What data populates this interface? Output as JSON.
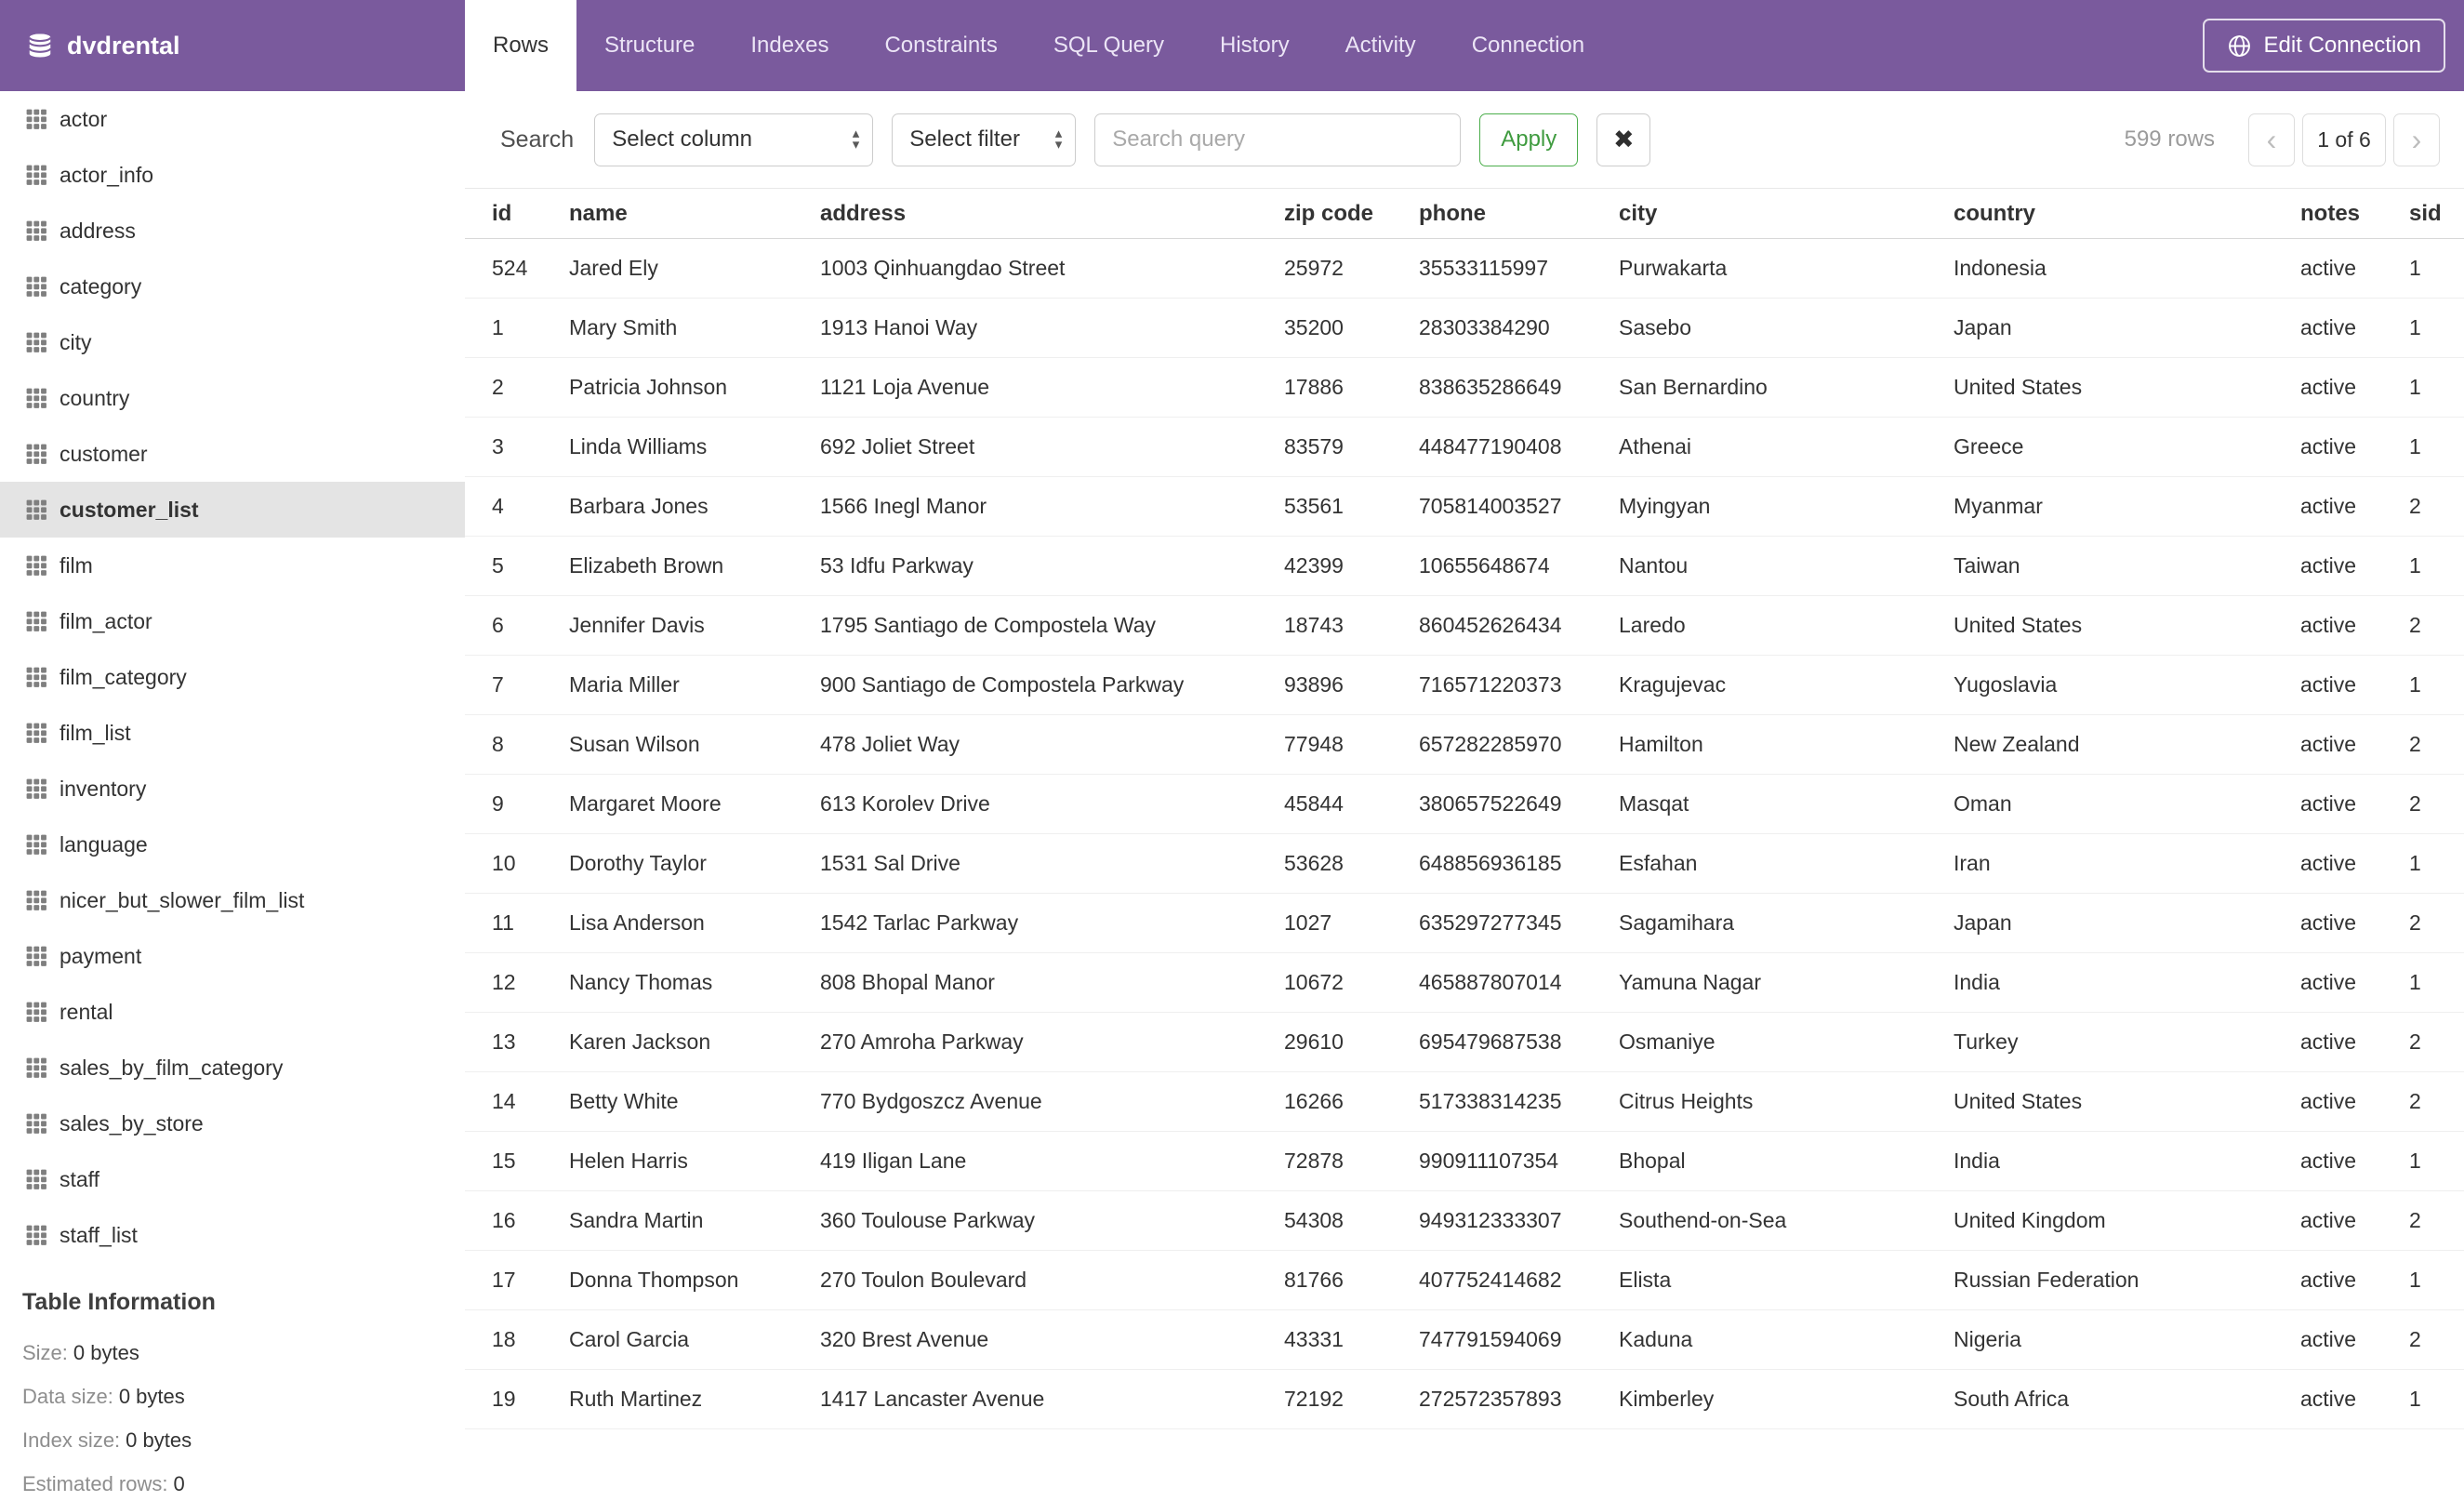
{
  "colors": {
    "header_purple": "#7a5a9d",
    "apply_green": "#4cae4c",
    "selected_row_bg": "#e4e4e4"
  },
  "app": {
    "title": "dvdrental",
    "edit_connection_label": "Edit Connection",
    "tabs": [
      {
        "label": "Rows",
        "active": true
      },
      {
        "label": "Structure",
        "active": false
      },
      {
        "label": "Indexes",
        "active": false
      },
      {
        "label": "Constraints",
        "active": false
      },
      {
        "label": "SQL Query",
        "active": false
      },
      {
        "label": "History",
        "active": false
      },
      {
        "label": "Activity",
        "active": false
      },
      {
        "label": "Connection",
        "active": false
      }
    ]
  },
  "sidebar": {
    "selected_table": "customer_list",
    "tables": [
      "actor",
      "actor_info",
      "address",
      "category",
      "city",
      "country",
      "customer",
      "customer_list",
      "film",
      "film_actor",
      "film_category",
      "film_list",
      "inventory",
      "language",
      "nicer_but_slower_film_list",
      "payment",
      "rental",
      "sales_by_film_category",
      "sales_by_store",
      "staff",
      "staff_list"
    ],
    "info": {
      "heading": "Table Information",
      "rows": [
        {
          "label": "Size:",
          "value": "0 bytes"
        },
        {
          "label": "Data size:",
          "value": "0 bytes"
        },
        {
          "label": "Index size:",
          "value": "0 bytes"
        },
        {
          "label": "Estimated rows:",
          "value": "0"
        }
      ]
    }
  },
  "toolbar": {
    "search_label": "Search",
    "column_select_placeholder": "Select column",
    "filter_select_placeholder": "Select filter",
    "query_placeholder": "Search query",
    "apply_label": "Apply",
    "clear_icon": "✖",
    "row_count": "599 rows",
    "pagination": {
      "prev": "‹",
      "current": "1 of 6",
      "next": "›"
    }
  },
  "table": {
    "columns": [
      "id",
      "name",
      "address",
      "zip code",
      "phone",
      "city",
      "country",
      "notes",
      "sid"
    ],
    "rows": [
      [
        "524",
        "Jared Ely",
        "1003 Qinhuangdao Street",
        "25972",
        "35533115997",
        "Purwakarta",
        "Indonesia",
        "active",
        "1"
      ],
      [
        "1",
        "Mary Smith",
        "1913 Hanoi Way",
        "35200",
        "28303384290",
        "Sasebo",
        "Japan",
        "active",
        "1"
      ],
      [
        "2",
        "Patricia Johnson",
        "1121 Loja Avenue",
        "17886",
        "838635286649",
        "San Bernardino",
        "United States",
        "active",
        "1"
      ],
      [
        "3",
        "Linda Williams",
        "692 Joliet Street",
        "83579",
        "448477190408",
        "Athenai",
        "Greece",
        "active",
        "1"
      ],
      [
        "4",
        "Barbara Jones",
        "1566 Inegl Manor",
        "53561",
        "705814003527",
        "Myingyan",
        "Myanmar",
        "active",
        "2"
      ],
      [
        "5",
        "Elizabeth Brown",
        "53 Idfu Parkway",
        "42399",
        "10655648674",
        "Nantou",
        "Taiwan",
        "active",
        "1"
      ],
      [
        "6",
        "Jennifer Davis",
        "1795 Santiago de Compostela Way",
        "18743",
        "860452626434",
        "Laredo",
        "United States",
        "active",
        "2"
      ],
      [
        "7",
        "Maria Miller",
        "900 Santiago de Compostela Parkway",
        "93896",
        "716571220373",
        "Kragujevac",
        "Yugoslavia",
        "active",
        "1"
      ],
      [
        "8",
        "Susan Wilson",
        "478 Joliet Way",
        "77948",
        "657282285970",
        "Hamilton",
        "New Zealand",
        "active",
        "2"
      ],
      [
        "9",
        "Margaret Moore",
        "613 Korolev Drive",
        "45844",
        "380657522649",
        "Masqat",
        "Oman",
        "active",
        "2"
      ],
      [
        "10",
        "Dorothy Taylor",
        "1531 Sal Drive",
        "53628",
        "648856936185",
        "Esfahan",
        "Iran",
        "active",
        "1"
      ],
      [
        "11",
        "Lisa Anderson",
        "1542 Tarlac Parkway",
        "1027",
        "635297277345",
        "Sagamihara",
        "Japan",
        "active",
        "2"
      ],
      [
        "12",
        "Nancy Thomas",
        "808 Bhopal Manor",
        "10672",
        "465887807014",
        "Yamuna Nagar",
        "India",
        "active",
        "1"
      ],
      [
        "13",
        "Karen Jackson",
        "270 Amroha Parkway",
        "29610",
        "695479687538",
        "Osmaniye",
        "Turkey",
        "active",
        "2"
      ],
      [
        "14",
        "Betty White",
        "770 Bydgoszcz Avenue",
        "16266",
        "517338314235",
        "Citrus Heights",
        "United States",
        "active",
        "2"
      ],
      [
        "15",
        "Helen Harris",
        "419 Iligan Lane",
        "72878",
        "990911107354",
        "Bhopal",
        "India",
        "active",
        "1"
      ],
      [
        "16",
        "Sandra Martin",
        "360 Toulouse Parkway",
        "54308",
        "949312333307",
        "Southend-on-Sea",
        "United Kingdom",
        "active",
        "2"
      ],
      [
        "17",
        "Donna Thompson",
        "270 Toulon Boulevard",
        "81766",
        "407752414682",
        "Elista",
        "Russian Federation",
        "active",
        "1"
      ],
      [
        "18",
        "Carol Garcia",
        "320 Brest Avenue",
        "43331",
        "747791594069",
        "Kaduna",
        "Nigeria",
        "active",
        "2"
      ],
      [
        "19",
        "Ruth Martinez",
        "1417 Lancaster Avenue",
        "72192",
        "272572357893",
        "Kimberley",
        "South Africa",
        "active",
        "1"
      ]
    ]
  }
}
